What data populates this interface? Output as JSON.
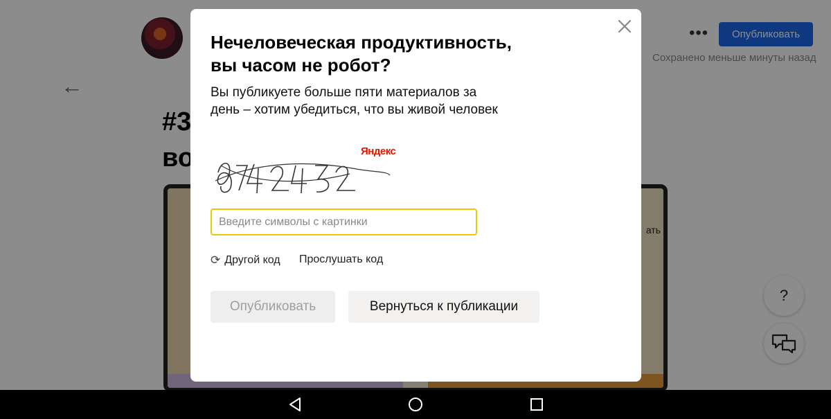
{
  "topbar": {
    "more_label": "•••",
    "publish_label": "Опубликовать",
    "saved_status": "Сохранено меньше минуты назад"
  },
  "article": {
    "title_line1": "#3",
    "title_line2": "во",
    "comic_text": "ать"
  },
  "fabs": {
    "help_label": "?"
  },
  "modal": {
    "title": "Нечеловеческая продуктивность,\nвы часом не робот?",
    "description": "Вы публикуете больше пяти материалов за\nдень – хотим убедиться, что вы живой человек",
    "captcha_brand": "Яндекс",
    "captcha_code_visual": "8742452",
    "input_placeholder": "Введите символы с картинки",
    "input_value": "",
    "refresh_label": "Другой код",
    "listen_label": "Прослушать код",
    "publish_button": "Опубликовать",
    "return_button": "Вернуться к публикации"
  },
  "colors": {
    "accent": "#1b66e8",
    "input_focus": "#f0c800",
    "yandex_red": "#e61400"
  },
  "icons": {
    "close": "close-icon",
    "refresh": "refresh-icon",
    "back": "arrow-left-icon",
    "chat": "chat-bubbles-icon",
    "nav_back": "triangle-back-icon",
    "nav_home": "circle-home-icon",
    "nav_recents": "square-recents-icon"
  }
}
